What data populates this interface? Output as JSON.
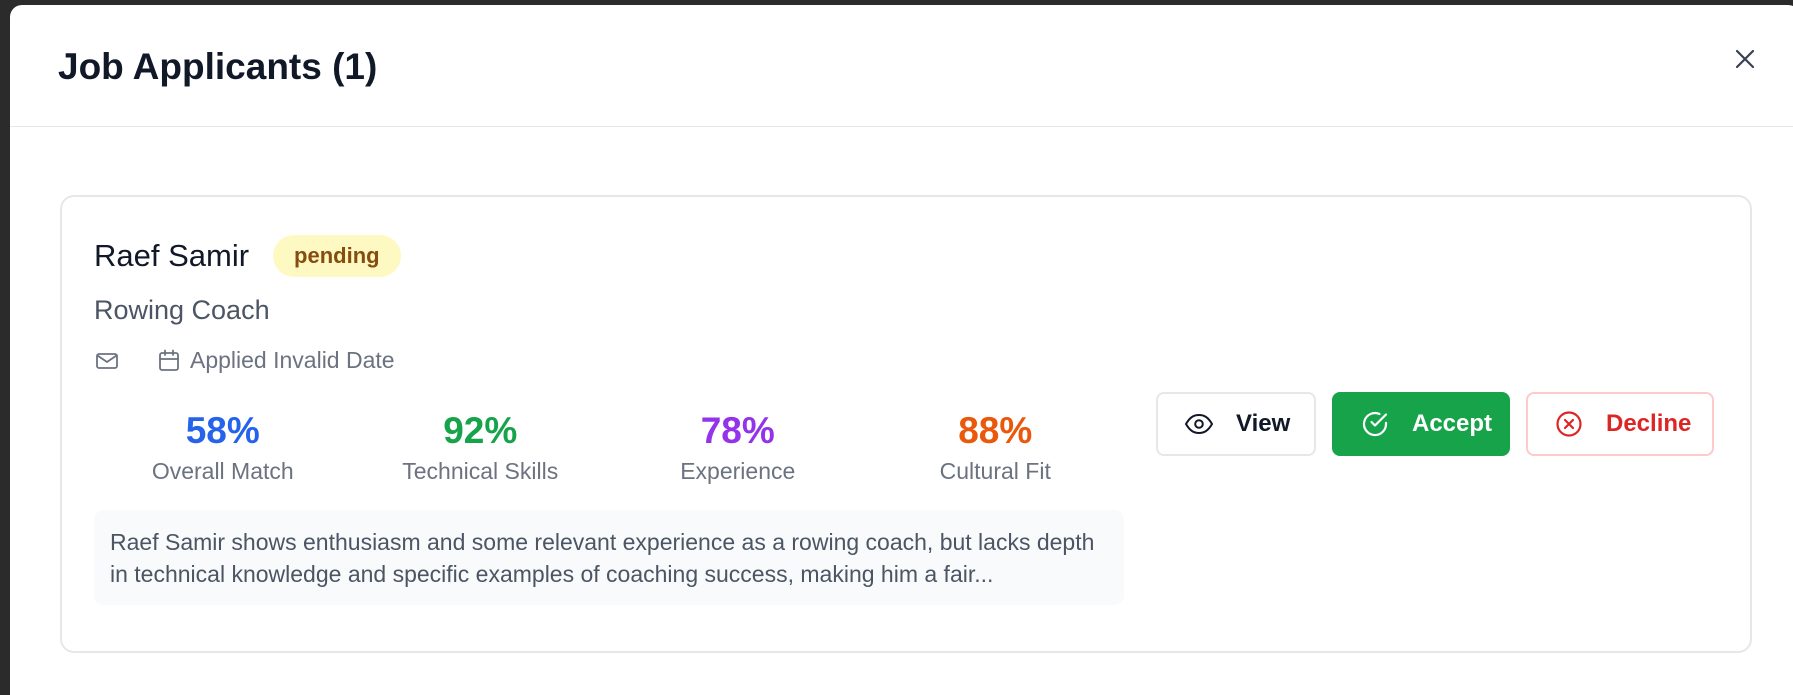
{
  "modal": {
    "title": "Job Applicants (1)",
    "close_icon": "close-icon"
  },
  "applicant": {
    "name": "Raef Samir",
    "status": "pending",
    "job_title": "Rowing Coach",
    "applied_text": "Applied Invalid Date",
    "icons": {
      "email": "mail-icon",
      "date": "calendar-icon"
    },
    "metrics": [
      {
        "value": "58%",
        "label": "Overall Match",
        "color": "#2563eb"
      },
      {
        "value": "92%",
        "label": "Technical Skills",
        "color": "#16a34a"
      },
      {
        "value": "78%",
        "label": "Experience",
        "color": "#9333ea"
      },
      {
        "value": "88%",
        "label": "Cultural Fit",
        "color": "#ea580c"
      }
    ],
    "summary": "Raef Samir shows enthusiasm and some relevant experience as a rowing coach, but lacks depth in technical knowledge and specific examples of coaching success, making him a fair..."
  },
  "actions": {
    "view_label": "View",
    "accept_label": "Accept",
    "decline_label": "Decline",
    "view_icon": "eye-icon",
    "accept_icon": "check-circle-icon",
    "decline_icon": "x-circle-icon"
  },
  "colors": {
    "status_badge_bg": "#fef9c3",
    "status_badge_text": "#854d0e",
    "accept": "#16a34a",
    "decline": "#dc2626"
  }
}
